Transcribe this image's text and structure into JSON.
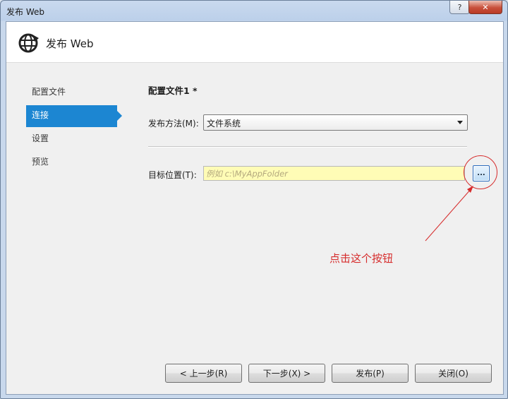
{
  "window": {
    "title": "发布 Web",
    "help_glyph": "?",
    "close_glyph": "✕"
  },
  "header": {
    "icon": "globe-publish-icon",
    "title": "发布 Web"
  },
  "nav": {
    "items": [
      {
        "label": "配置文件",
        "active": false
      },
      {
        "label": "连接",
        "active": true
      },
      {
        "label": "设置",
        "active": false
      },
      {
        "label": "预览",
        "active": false
      }
    ]
  },
  "main": {
    "section_title": "配置文件1 *",
    "publish_method": {
      "label": "发布方法(M):",
      "value": "文件系统"
    },
    "target_location": {
      "label": "目标位置(T):",
      "value": "",
      "placeholder": "例如 c:\\MyAppFolder",
      "browse_label": "..."
    }
  },
  "annotation": {
    "text": "点击这个按钮",
    "color": "#d62c2c"
  },
  "footer": {
    "prev_label": "< 上一步(R)",
    "next_label": "下一步(X) >",
    "publish_label": "发布(P)",
    "close_label": "关闭(O)"
  },
  "colors": {
    "accent": "#1c86d2",
    "input_highlight": "#fffcb6"
  }
}
